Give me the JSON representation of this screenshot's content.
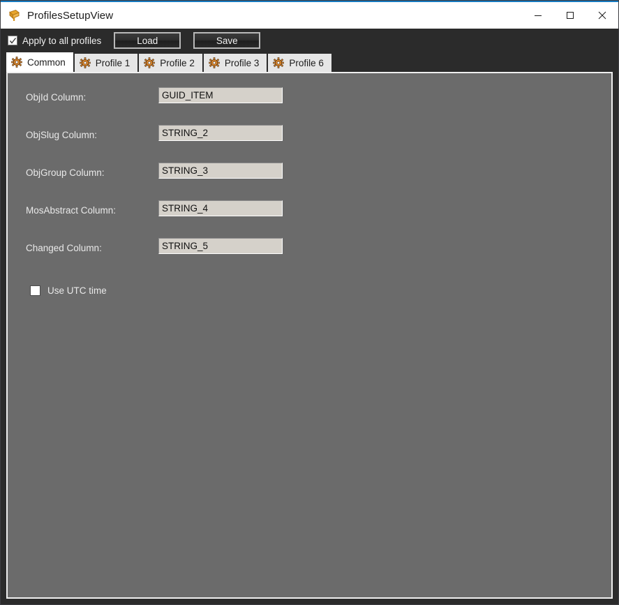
{
  "window": {
    "title": "ProfilesSetupView",
    "app_icon": "app-icon",
    "accent_color": "#1679c0",
    "controls": {
      "minimize": "minimize-icon",
      "maximize": "maximize-icon",
      "close": "close-icon"
    }
  },
  "toolbar": {
    "apply_all": {
      "label": "Apply to all profiles",
      "checked": true
    },
    "load_label": "Load",
    "save_label": "Save"
  },
  "tabs": [
    {
      "label": "Common",
      "icon": "gear-icon",
      "active": true
    },
    {
      "label": "Profile 1",
      "icon": "gear-icon",
      "active": false
    },
    {
      "label": "Profile 2",
      "icon": "gear-icon",
      "active": false
    },
    {
      "label": "Profile 3",
      "icon": "gear-icon",
      "active": false
    },
    {
      "label": "Profile 6",
      "icon": "gear-icon",
      "active": false
    }
  ],
  "form": {
    "fields": [
      {
        "label": "ObjId Column:",
        "value": "GUID_ITEM"
      },
      {
        "label": "ObjSlug Column:",
        "value": "STRING_2"
      },
      {
        "label": "ObjGroup Column:",
        "value": "STRING_3"
      },
      {
        "label": "MosAbstract Column:",
        "value": "STRING_4"
      },
      {
        "label": "Changed Column:",
        "value": "STRING_5"
      }
    ],
    "utc": {
      "label": "Use UTC time",
      "checked": false
    }
  },
  "colors": {
    "panel_bg": "#6b6b6b",
    "chrome_bg": "#2b2b2b",
    "titlebar_bg": "#ffffff",
    "accent": "#1679c0",
    "input_bg": "#d5d1ca",
    "tab_active_bg": "#ffffff",
    "tab_inactive_bg": "#e6e6e6",
    "gear_icon": "#e08a2e"
  }
}
